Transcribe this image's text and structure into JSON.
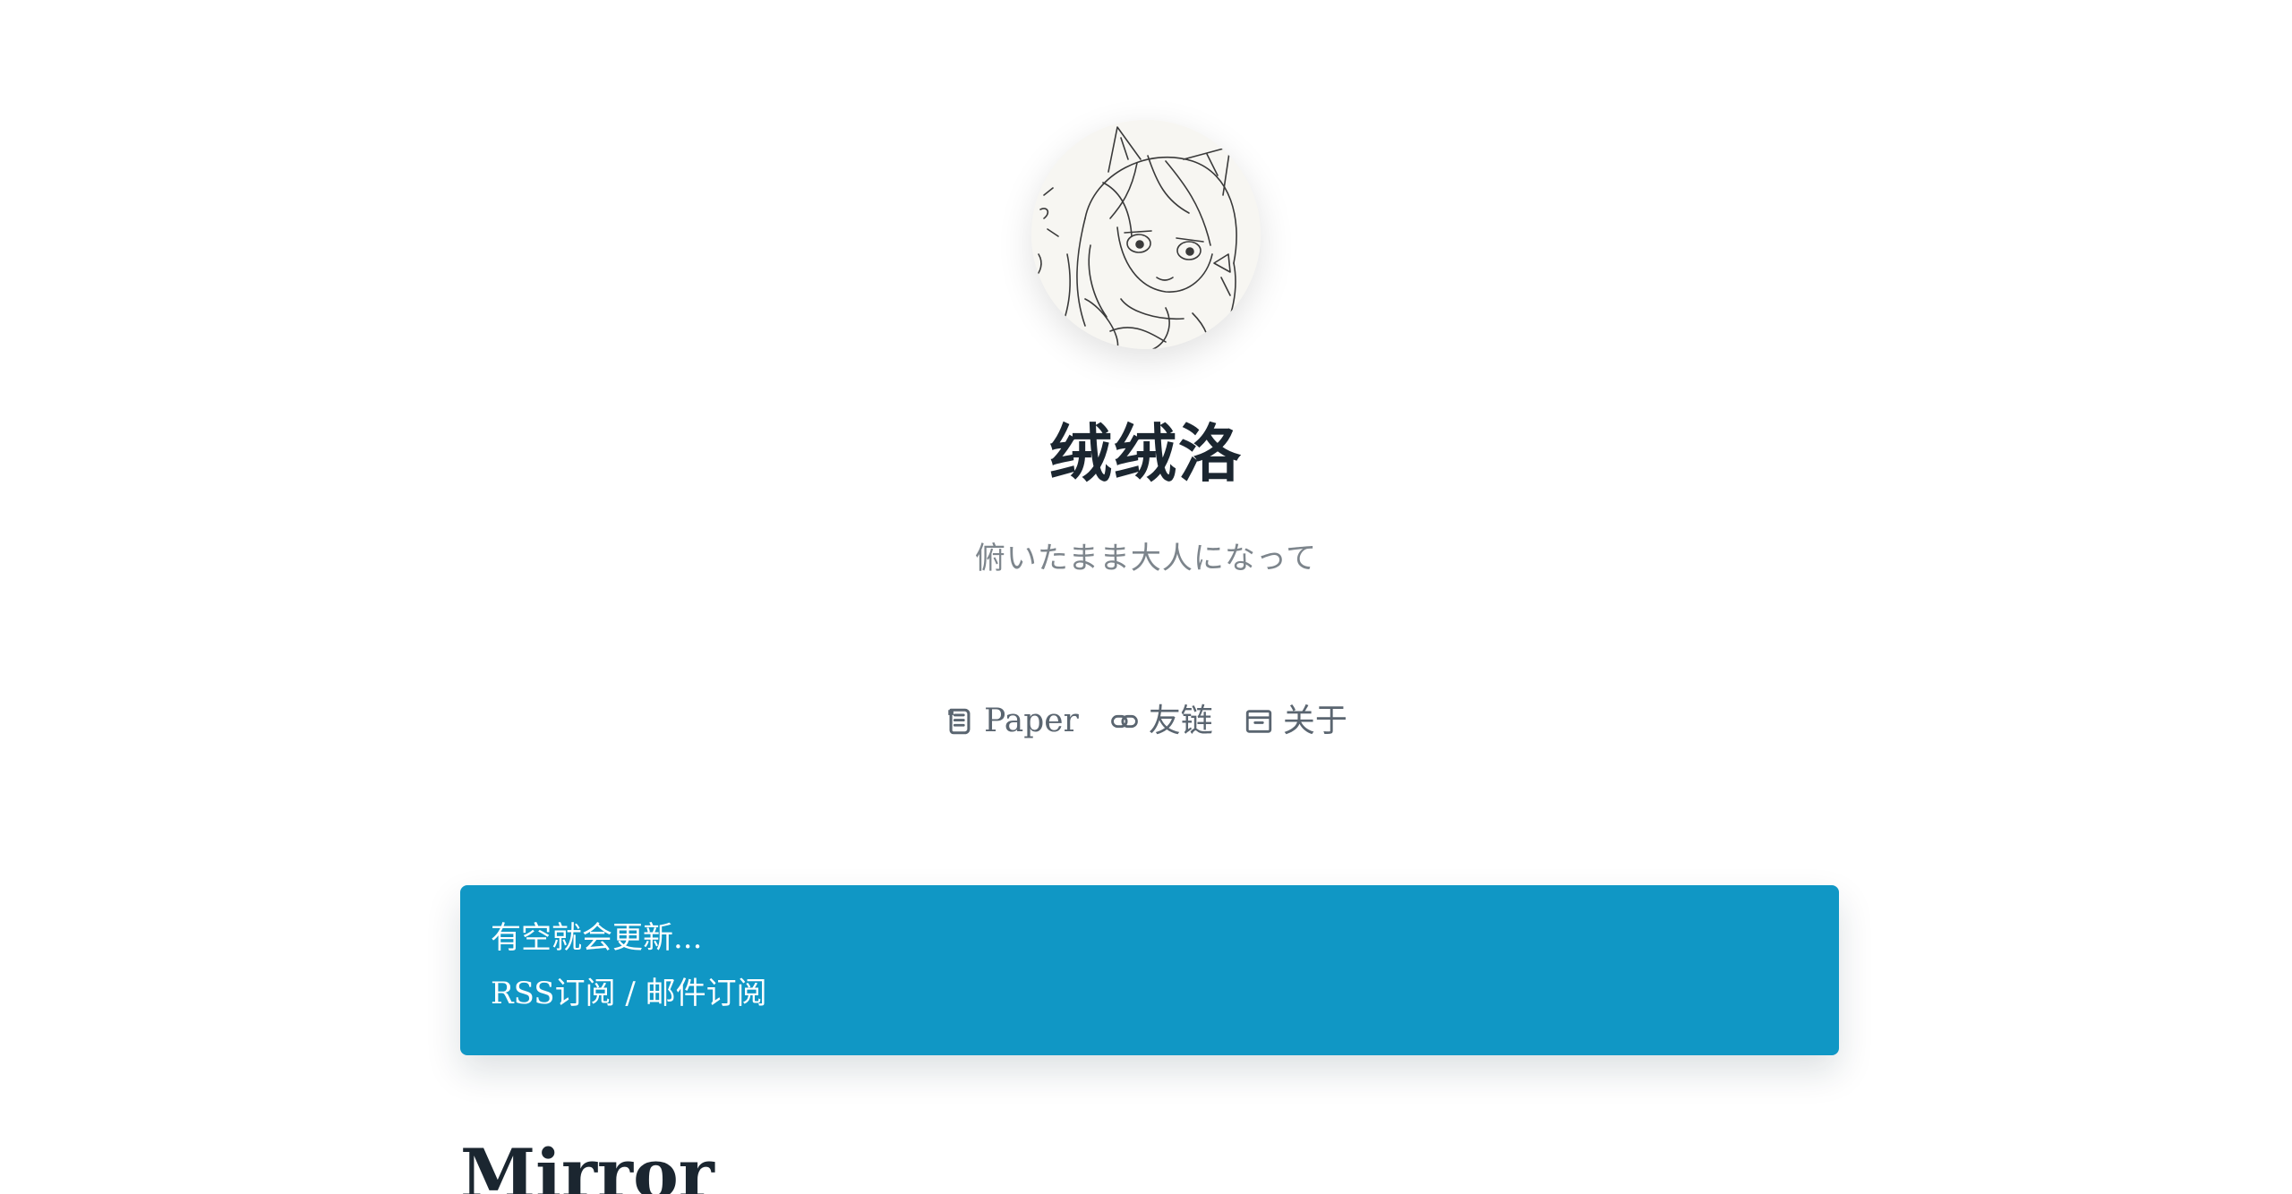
{
  "site": {
    "title": "绒绒洛",
    "subtitle": "俯いたまま大人になって"
  },
  "avatar": {
    "icon": "avatar-sketch"
  },
  "nav": {
    "items": [
      {
        "label": "Paper",
        "icon": "scroll-icon"
      },
      {
        "label": "友链",
        "icon": "link-icon"
      },
      {
        "label": "关于",
        "icon": "archive-box-icon"
      }
    ]
  },
  "notice": {
    "line1": "有空就会更新...",
    "rss_label": "RSS订阅",
    "separator": " / ",
    "mail_label": "邮件订阅",
    "background": "#1097c5"
  },
  "content": {
    "heading": "Mirror"
  },
  "colors": {
    "accent": "#1097c5",
    "text": "#1b2630",
    "muted": "#7d858c",
    "nav": "#5a6570"
  }
}
